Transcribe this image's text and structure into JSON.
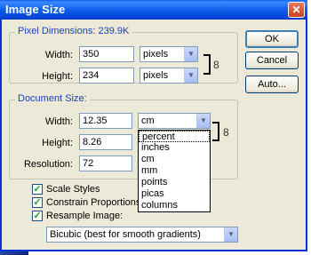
{
  "window": {
    "title": "Image Size",
    "close_glyph": "✕"
  },
  "pixel_dimensions": {
    "label": "Pixel Dimensions: 239.9K",
    "width_label": "Width:",
    "width_value": "350",
    "width_unit": "pixels",
    "height_label": "Height:",
    "height_value": "234",
    "height_unit": "pixels"
  },
  "document_size": {
    "label": "Document Size:",
    "width_label": "Width:",
    "width_value": "12.35",
    "width_unit": "cm",
    "height_label": "Height:",
    "height_value": "8.26",
    "resolution_label": "Resolution:",
    "resolution_value": "72"
  },
  "unit_options": [
    "percent",
    "inches",
    "cm",
    "mm",
    "points",
    "picas",
    "columns"
  ],
  "buttons": {
    "ok": "OK",
    "cancel": "Cancel",
    "auto": "Auto..."
  },
  "options": {
    "scale_styles": "Scale Styles",
    "constrain_proportions": "Constrain Proportions",
    "resample_image": "Resample Image:",
    "resample_method": "Bicubic (best for smooth gradients)"
  },
  "glyphs": {
    "dropdown": "▼",
    "check": "✓",
    "chain": "8"
  }
}
